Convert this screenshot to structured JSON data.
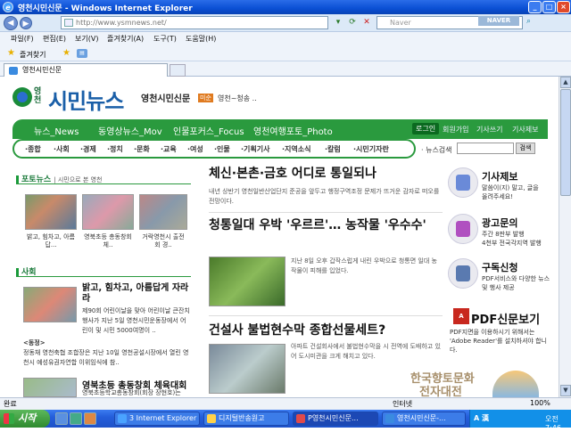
{
  "window": {
    "title": "영천시민신문 - Windows Internet Explorer",
    "controls": [
      "_",
      "□",
      "×"
    ]
  },
  "addressbar": {
    "url": "http://www.ysmnews.net/",
    "search_placeholder": "Naver",
    "search_badge": "NAVER"
  },
  "menu": [
    "파일(F)",
    "편집(E)",
    "보기(V)",
    "즐겨찾기(A)",
    "도구(T)",
    "도움말(H)"
  ],
  "favorites": {
    "label": "즐겨찾기"
  },
  "tab": {
    "label": "영천시민신문"
  },
  "site": {
    "logo_small": "영천",
    "logo_main": "시민뉴스",
    "logo_sub": "영천시민신문",
    "logo_tag": "미순",
    "slogan": "영천~청송 ..",
    "main_nav": [
      "뉴스_News",
      "동영상뉴스_Mov",
      "인물포커스_Focus",
      "영천여행포토_Photo"
    ],
    "login": "로그인",
    "util_links": [
      "회원가입",
      "기사쓰기",
      "기사제보"
    ],
    "sub_nav": [
      "·종합",
      "·사회",
      "·경제",
      "·정치",
      "·문화",
      "·교육",
      "·여성",
      "·인물",
      "·기획기사",
      "·지역소식",
      "·칼럼",
      "·시민기자란"
    ],
    "search_label": "· 뉴스검색",
    "search_button": "검색"
  },
  "photonews": {
    "title": "포토뉴스",
    "subtitle": "| 시민으로 본 영천",
    "items": [
      {
        "caption": "밝고, 힘차고, 아름답..."
      },
      {
        "caption": "영북초등 총동창회 체.."
      },
      {
        "caption": "거락영천시 출전 회 경.."
      }
    ]
  },
  "society": {
    "title": "사회",
    "headline": "밝고, 힘차고, 아름답게 자라라",
    "text": "제90회 어린이날을 맞아 어린이날 큰잔치 행사가 지난 5일 영천시민운동장에서 어린이 및 시민 5000여명이 ..",
    "section2": "<동정>",
    "text2": "정동채 영천축협 조합장은 지난 10일 영천공설시장에서 열린 영천시 예성유권자연합 이위임식에 참..",
    "headline2": "영북초등 총동창회 체육대회",
    "text3": "영북초등학교총동창회(회장 장현호)는"
  },
  "main": {
    "articles": [
      {
        "title": "체신·본촌·금호 어디로 통일되나",
        "summary": "내년 상반기 영천일반산업단지 준공을 앞두고 행정구역조정 문제가 뜨거운 감자로 떠오를 전망이다."
      },
      {
        "title": "청통일대 우박 '우르르'… 농작물 '우수수'",
        "summary": "지난 8일 오후 갑작스럽게 내린 우박으로 청통면 일대 농작물이 피해를 입었다."
      },
      {
        "title": "건설사 불법현수막 종합선물세트?",
        "summary": "아파트 건설회사에서 불법현수막을 시 전역에 도배하고 있어 도시미관을 크게 해치고 있다."
      }
    ]
  },
  "sidebar": {
    "items": [
      {
        "title": "기사제보",
        "text": "말씀이(지) 말고, 글을 올려주세요!",
        "icon": "pen-icon"
      },
      {
        "title": "광고문의",
        "text": "주간 8판부 발행\n4천부 전국각지역 발행",
        "icon": "megaphone-icon"
      },
      {
        "title": "구독신청",
        "text": "PDF서비스와 다양한 뉴스 및 행사 제공",
        "icon": "newspaper-icon"
      },
      {
        "title": "PDF신문보기",
        "text": "PDF지면을 이용하시기 위해서는 'Adobe Reader'를 설치하셔야 합니다.",
        "icon": "pdf-icon"
      }
    ]
  },
  "watermark": {
    "line1": "한국향토문화",
    "line2": "전자대전"
  },
  "statusbar": {
    "status": "완료",
    "zone": "인터넷",
    "zoom": "100%"
  },
  "taskbar": {
    "start": "시작",
    "items": [
      "3 Internet Explorer",
      "디지털반송원고",
      "P영천시민신문...",
      "영천시민신문-..."
    ],
    "ime": "A 漢",
    "clock": "오전 7:46"
  },
  "colors": {
    "brand_green": "#2a9a3e",
    "brand_blue": "#1a5fa8",
    "xp_blue": "#245edb"
  }
}
